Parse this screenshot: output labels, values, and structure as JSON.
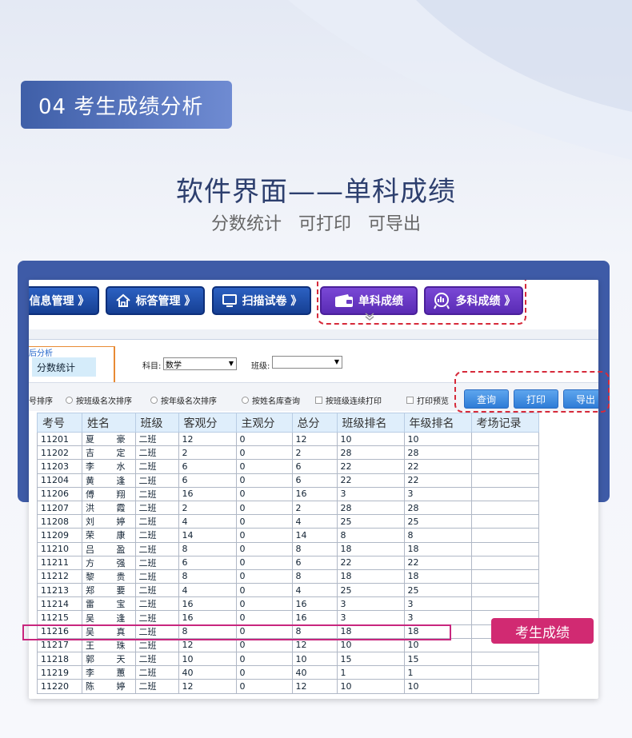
{
  "header": {
    "section_badge": "04 考生成绩分析",
    "title": "软件界面——单科成绩",
    "subtitle": "分数统计 可打印 可导出"
  },
  "toolbar": {
    "buttons": [
      {
        "label": "信息管理 》",
        "style": "blue"
      },
      {
        "label": "标答管理 》",
        "style": "blue",
        "icon": "home-icon"
      },
      {
        "label": "扫描试卷 》",
        "style": "blue",
        "icon": "monitor-icon"
      },
      {
        "label": "单科成绩",
        "style": "purple",
        "icon": "wallet-icon"
      },
      {
        "label": "多科成绩 》",
        "style": "purple",
        "icon": "chart-badge-icon"
      }
    ]
  },
  "panel": {
    "tab_group_label": "后分析",
    "tab_label": "分数统计",
    "subject_label": "科目:",
    "subject_value": "数学",
    "class_label": "班级:",
    "class_value": ""
  },
  "options": {
    "items": [
      "号排序",
      "按班级名次排序",
      "按年级名次排序",
      "按姓名库查询",
      "按班级连续打印",
      "打印预览"
    ],
    "actions": [
      "查询",
      "打印",
      "导出"
    ]
  },
  "table": {
    "columns": [
      "考号",
      "姓名",
      "班级",
      "客观分",
      "主观分",
      "总分",
      "班级排名",
      "年级排名",
      "考场记录"
    ],
    "rows": [
      [
        "11201",
        "夏 豪",
        "二班",
        "12",
        "0",
        "12",
        "10",
        "10",
        ""
      ],
      [
        "11202",
        "吉 定",
        "二班",
        "2",
        "0",
        "2",
        "28",
        "28",
        ""
      ],
      [
        "11203",
        "李 水",
        "二班",
        "6",
        "0",
        "6",
        "22",
        "22",
        ""
      ],
      [
        "11204",
        "黄 逢",
        "二班",
        "6",
        "0",
        "6",
        "22",
        "22",
        ""
      ],
      [
        "11206",
        "傅 翔",
        "二班",
        "16",
        "0",
        "16",
        "3",
        "3",
        ""
      ],
      [
        "11207",
        "洪 霞",
        "二班",
        "2",
        "0",
        "2",
        "28",
        "28",
        ""
      ],
      [
        "11208",
        "刘 婷",
        "二班",
        "4",
        "0",
        "4",
        "25",
        "25",
        ""
      ],
      [
        "11209",
        "荣 康",
        "二班",
        "14",
        "0",
        "14",
        "8",
        "8",
        ""
      ],
      [
        "11210",
        "吕 盈",
        "二班",
        "8",
        "0",
        "8",
        "18",
        "18",
        ""
      ],
      [
        "11211",
        "方 强",
        "二班",
        "6",
        "0",
        "6",
        "22",
        "22",
        ""
      ],
      [
        "11212",
        "黎 贵",
        "二班",
        "8",
        "0",
        "8",
        "18",
        "18",
        ""
      ],
      [
        "11213",
        "郑 要",
        "二班",
        "4",
        "0",
        "4",
        "25",
        "25",
        ""
      ],
      [
        "11214",
        "雷 宝",
        "二班",
        "16",
        "0",
        "16",
        "3",
        "3",
        ""
      ],
      [
        "11215",
        "吴 逢",
        "二班",
        "16",
        "0",
        "16",
        "3",
        "3",
        ""
      ],
      [
        "11216",
        "吴 真",
        "二班",
        "8",
        "0",
        "8",
        "18",
        "18",
        ""
      ],
      [
        "11217",
        "王 珠",
        "二班",
        "12",
        "0",
        "12",
        "10",
        "10",
        ""
      ],
      [
        "11218",
        "郭 天",
        "二班",
        "10",
        "0",
        "10",
        "15",
        "15",
        ""
      ],
      [
        "11219",
        "李 蕙",
        "二班",
        "40",
        "0",
        "40",
        "1",
        "1",
        ""
      ],
      [
        "11220",
        "陈 婷",
        "二班",
        "12",
        "0",
        "12",
        "10",
        "10",
        ""
      ]
    ],
    "highlighted_row": "11216"
  },
  "callout": {
    "label": "考生成绩"
  },
  "colors": {
    "frame_blue": "#3e5ba7",
    "toolbar_blue": "#163f93",
    "toolbar_purple": "#5a2bb4",
    "dash_red": "#d62a3a",
    "callout_pink": "#d12a72"
  }
}
